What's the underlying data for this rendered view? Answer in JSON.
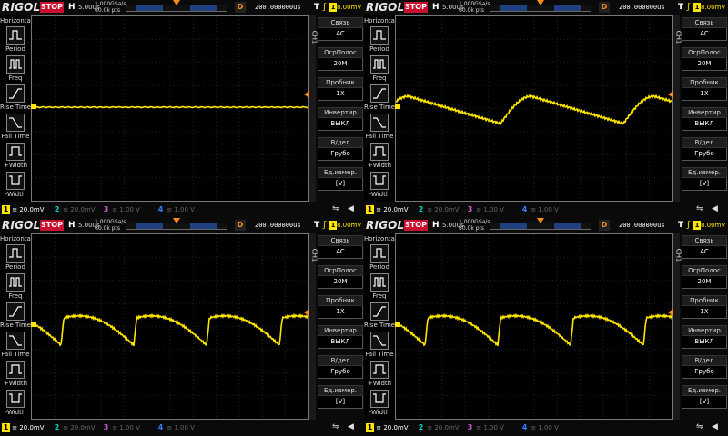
{
  "colors": {
    "ch1": "#ffe600",
    "ch2": "#00d3c8",
    "ch3": "#d060d0",
    "ch4": "#3a7cff",
    "trigger": "#ff8c1a",
    "stop": "#c8102e"
  },
  "panels": [
    {
      "brand": "RIGOL",
      "status": "STOP",
      "h_label": "H",
      "timebase": "5.00us",
      "sample_rate": "1.000GSa/s",
      "points": "60.0k pts",
      "delay_label": "D",
      "offset": "200.000000us",
      "trig_label": "T",
      "trig_source": "1",
      "trig_level": "8.00mV",
      "ch1_tag": "CH1",
      "horizontal_title": "Horizontal",
      "menu_left": [
        "Period",
        "Freq",
        "Rise Time",
        "Fall Time",
        "+Width",
        "-Width"
      ],
      "menu_right": [
        {
          "label": "Связь",
          "value": "AC"
        },
        {
          "label": "ОгрПолос",
          "value": "20M"
        },
        {
          "label": "Пробник",
          "value": "1X"
        },
        {
          "label": "Инвертир",
          "value": "ВЫКЛ"
        },
        {
          "label": "В/дел",
          "value": "Грубо"
        },
        {
          "label": "Ед.измер.",
          "value": "[V]"
        }
      ],
      "channels": [
        {
          "num": "1",
          "scale": "20.0mV"
        },
        {
          "num": "2",
          "scale": "20.0mV"
        },
        {
          "num": "3",
          "scale": "1.00 V"
        },
        {
          "num": "4",
          "scale": "1.00 V"
        }
      ],
      "waveform": "flat"
    },
    {
      "brand": "RIGOL",
      "status": "STOP",
      "h_label": "H",
      "timebase": "5.00us",
      "sample_rate": "1.000GSa/s",
      "points": "60.0k pts",
      "delay_label": "D",
      "offset": "200.000000us",
      "trig_label": "T",
      "trig_source": "1",
      "trig_level": "8.00mV",
      "ch1_tag": "CH1",
      "horizontal_title": "Horizontal",
      "menu_left": [
        "Period",
        "Freq",
        "Rise Time",
        "Fall Time",
        "+Width",
        "-Width"
      ],
      "menu_right": [
        {
          "label": "Связь",
          "value": "AC"
        },
        {
          "label": "ОгрПолос",
          "value": "20M"
        },
        {
          "label": "Пробник",
          "value": "1X"
        },
        {
          "label": "Инвертир",
          "value": "ВЫКЛ"
        },
        {
          "label": "В/дел",
          "value": "Грубо"
        },
        {
          "label": "Ед.измер.",
          "value": "[V]"
        }
      ],
      "channels": [
        {
          "num": "1",
          "scale": "20.0mV"
        },
        {
          "num": "2",
          "scale": "20.0mV"
        },
        {
          "num": "3",
          "scale": "1.00 V"
        },
        {
          "num": "4",
          "scale": "1.00 V"
        }
      ],
      "waveform": "slow"
    },
    {
      "brand": "RIGOL",
      "status": "STOP",
      "h_label": "H",
      "timebase": "5.00us",
      "sample_rate": "1.000GSa/s",
      "points": "60.0k pts",
      "delay_label": "D",
      "offset": "200.000000us",
      "trig_label": "T",
      "trig_source": "1",
      "trig_level": "8.00mV",
      "ch1_tag": "CH1",
      "horizontal_title": "Horizontal",
      "menu_left": [
        "Period",
        "Freq",
        "Rise Time",
        "Fall Time",
        "+Width",
        "-Width"
      ],
      "menu_right": [
        {
          "label": "Связь",
          "value": "AC"
        },
        {
          "label": "ОгрПолос",
          "value": "20M"
        },
        {
          "label": "Пробник",
          "value": "1X"
        },
        {
          "label": "Инвертир",
          "value": "ВЫКЛ"
        },
        {
          "label": "В/дел",
          "value": "Грубо"
        },
        {
          "label": "Ед.измер.",
          "value": "[V]"
        }
      ],
      "channels": [
        {
          "num": "1",
          "scale": "20.0mV"
        },
        {
          "num": "2",
          "scale": "20.0mV"
        },
        {
          "num": "3",
          "scale": "1.00 V"
        },
        {
          "num": "4",
          "scale": "1.00 V"
        }
      ],
      "waveform": "fast"
    },
    {
      "brand": "RIGOL",
      "status": "STOP",
      "h_label": "H",
      "timebase": "5.00us",
      "sample_rate": "1.000GSa/s",
      "points": "60.0k pts",
      "delay_label": "D",
      "offset": "200.000000us",
      "trig_label": "T",
      "trig_source": "1",
      "trig_level": "8.00mV",
      "ch1_tag": "CH1",
      "horizontal_title": "Horizontal",
      "menu_left": [
        "Period",
        "Freq",
        "Rise Time",
        "Fall Time",
        "+Width",
        "-Width"
      ],
      "menu_right": [
        {
          "label": "Связь",
          "value": "AC"
        },
        {
          "label": "ОгрПолос",
          "value": "20M"
        },
        {
          "label": "Пробник",
          "value": "1X"
        },
        {
          "label": "Инвертир",
          "value": "ВЫКЛ"
        },
        {
          "label": "В/дел",
          "value": "Грубо"
        },
        {
          "label": "Ед.измер.",
          "value": "[V]"
        }
      ],
      "channels": [
        {
          "num": "1",
          "scale": "20.0mV"
        },
        {
          "num": "2",
          "scale": "20.0mV"
        },
        {
          "num": "3",
          "scale": "1.00 V"
        },
        {
          "num": "4",
          "scale": "1.00 V"
        }
      ],
      "waveform": "fast"
    }
  ]
}
